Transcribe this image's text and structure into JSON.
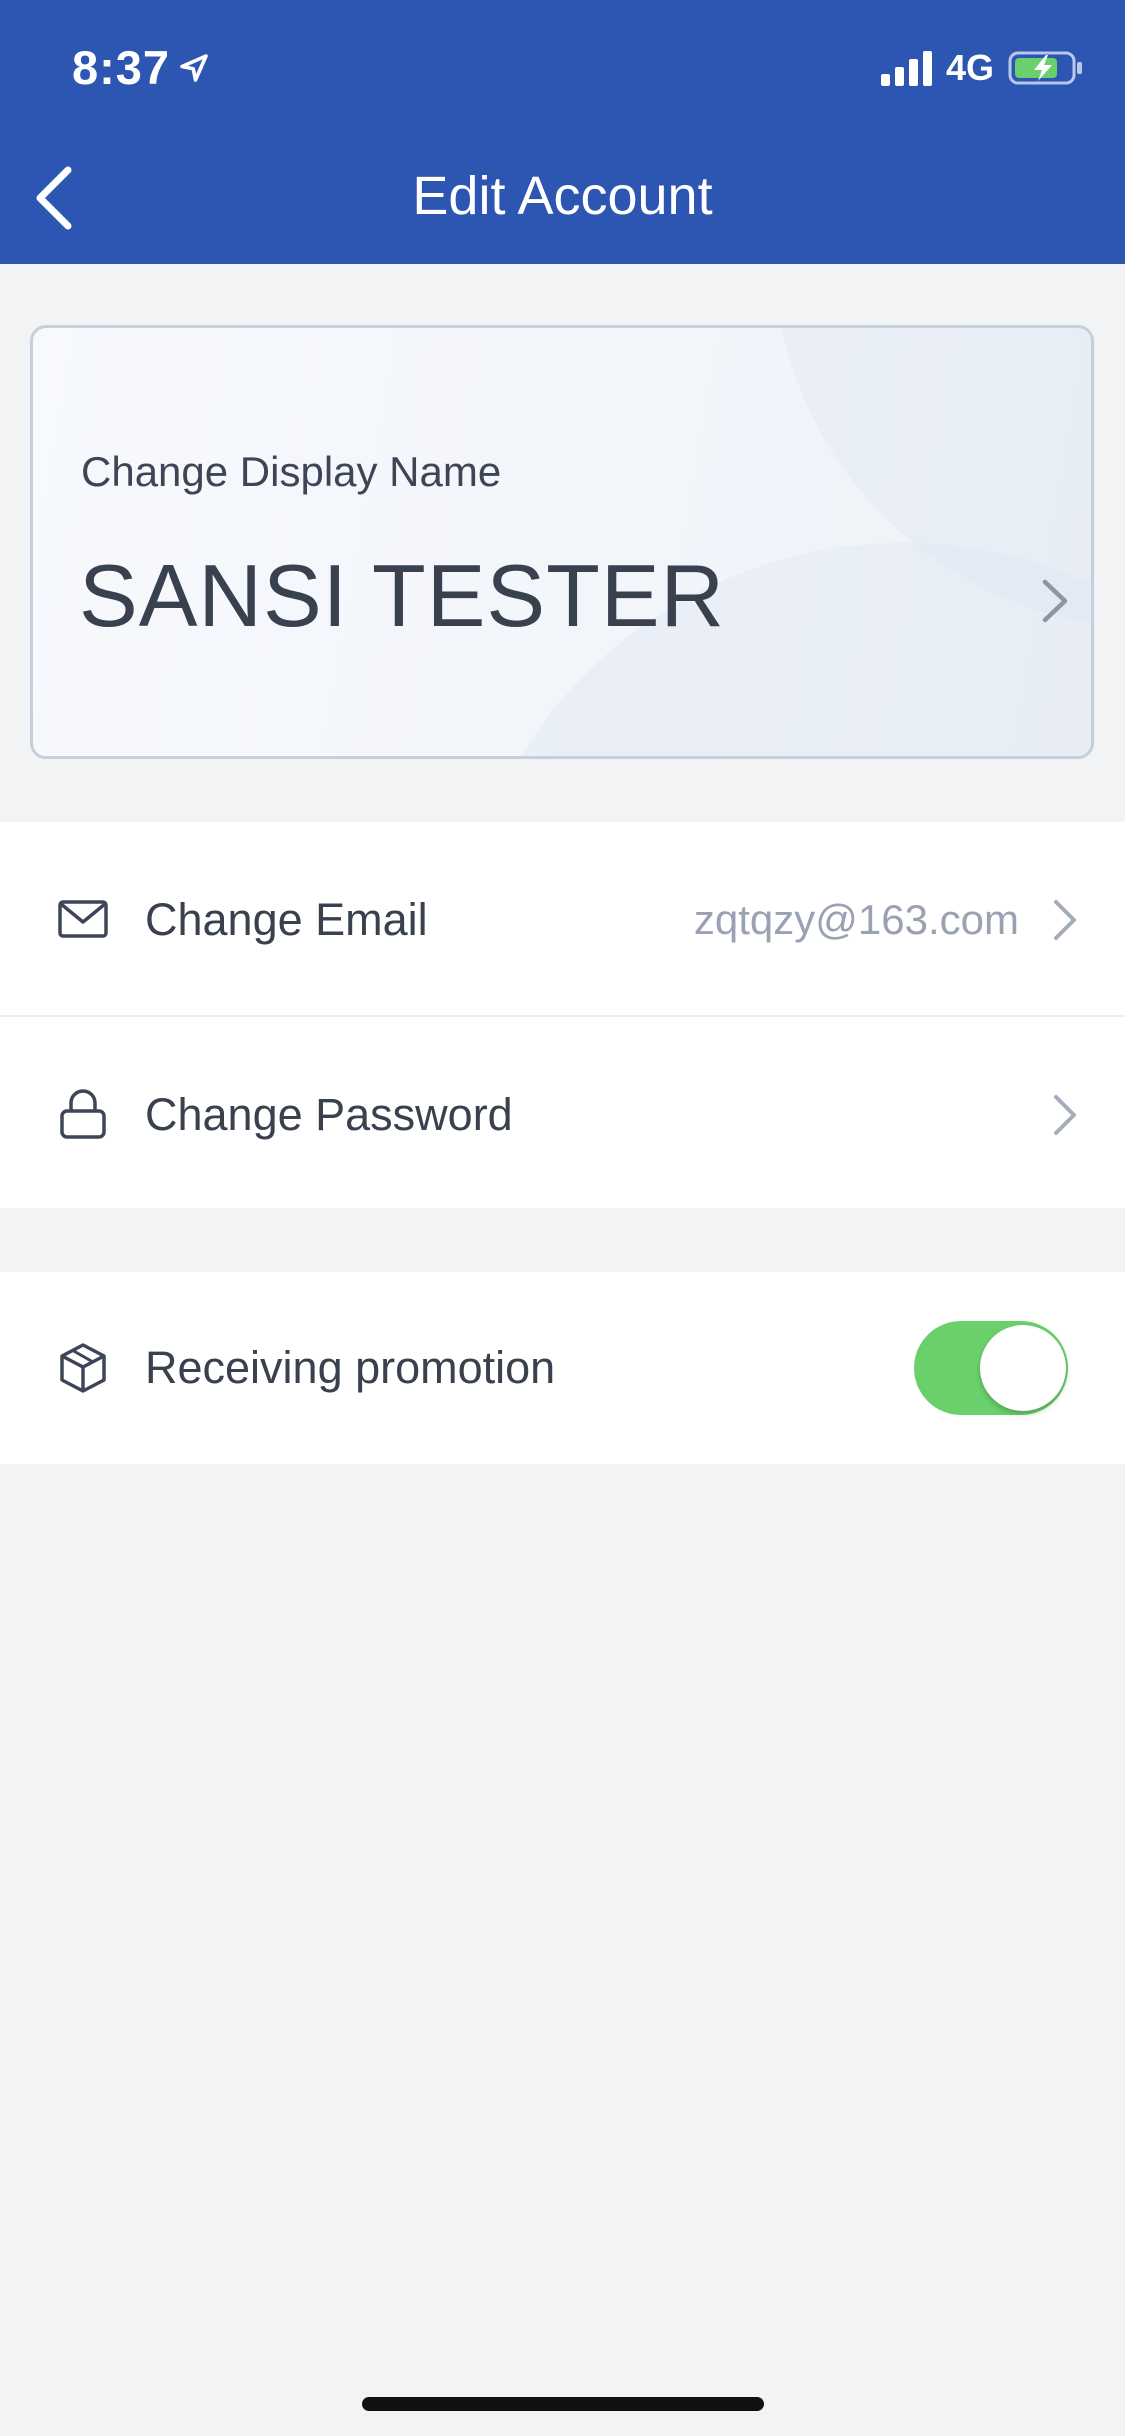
{
  "status_bar": {
    "time": "8:37",
    "network": "4G",
    "icons": [
      "location-arrow-icon",
      "cellular-signal-icon",
      "battery-charging-icon"
    ]
  },
  "nav": {
    "title": "Edit Account",
    "back_icon": "chevron-left-icon"
  },
  "display_name_card": {
    "label": "Change Display Name",
    "value": "SANSI TESTER",
    "chevron_icon": "chevron-right-icon"
  },
  "account_rows": [
    {
      "icon": "mail-icon",
      "label": "Change Email",
      "value": "zqtqzy@163.com"
    },
    {
      "icon": "lock-icon",
      "label": "Change Password",
      "value": ""
    }
  ],
  "promotion": {
    "icon": "package-icon",
    "label": "Receiving promotion",
    "enabled": true
  },
  "colors": {
    "header": "#2d56b3",
    "background": "#f2f3f5",
    "toggle_on": "#6ad06c",
    "secondary_text": "#99a1b2"
  }
}
